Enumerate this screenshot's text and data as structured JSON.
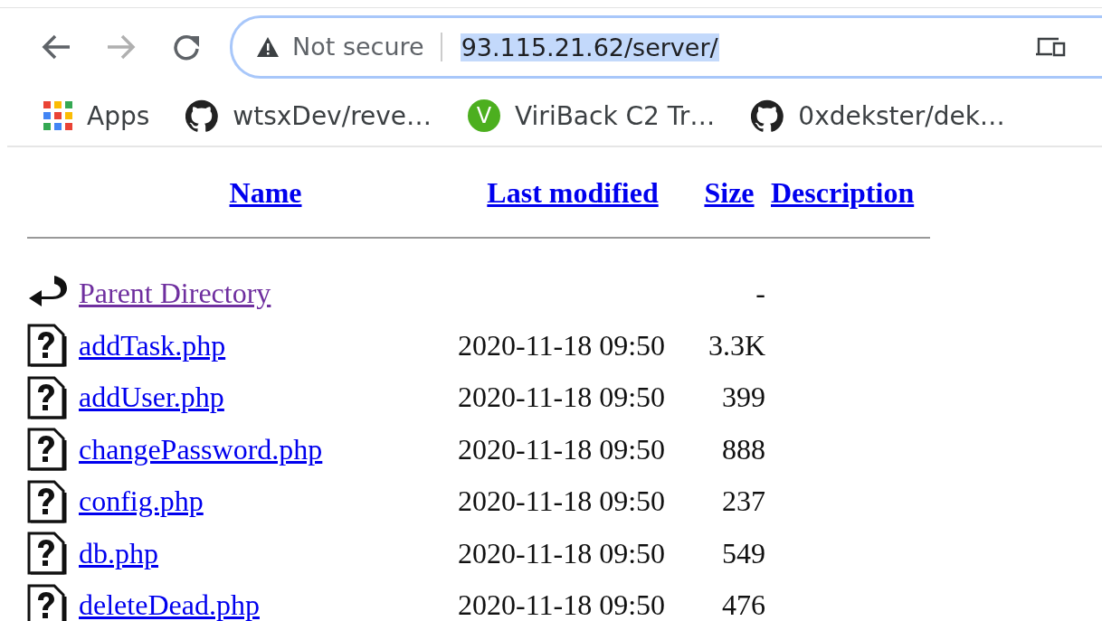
{
  "toolbar": {
    "nav": [
      {
        "kind": "back",
        "disabled": false
      },
      {
        "kind": "forward",
        "disabled": true
      },
      {
        "kind": "reload",
        "disabled": false
      }
    ],
    "security": "Not secure",
    "url": "93.115.21.62/server/",
    "url_selected": true
  },
  "bookmarks": [
    {
      "kind": "apps",
      "label": "Apps"
    },
    {
      "kind": "github",
      "label": "wtsxDev/reve…"
    },
    {
      "kind": "letter",
      "favicon_text": "V",
      "label": "ViriBack C2 Tr…"
    },
    {
      "kind": "github",
      "label": "0xdekster/dek…"
    }
  ],
  "listing": {
    "columns": [
      "Name",
      "Last modified",
      "Size",
      "Description"
    ],
    "rows": [
      {
        "kind": "parent",
        "name": "Parent Directory",
        "visited": true,
        "modified": "",
        "size": "-"
      },
      {
        "kind": "file",
        "name": "addTask.php",
        "visited": false,
        "modified": "2020-11-18 09:50",
        "size": "3.3K"
      },
      {
        "kind": "file",
        "name": "addUser.php",
        "visited": false,
        "modified": "2020-11-18 09:50",
        "size": "399"
      },
      {
        "kind": "file",
        "name": "changePassword.php",
        "visited": false,
        "modified": "2020-11-18 09:50",
        "size": "888"
      },
      {
        "kind": "file",
        "name": "config.php",
        "visited": false,
        "modified": "2020-11-18 09:50",
        "size": "237"
      },
      {
        "kind": "file",
        "name": "db.php",
        "visited": false,
        "modified": "2020-11-18 09:50",
        "size": "549"
      },
      {
        "kind": "file",
        "name": "deleteDead.php",
        "visited": false,
        "modified": "2020-11-18 09:50",
        "size": "476"
      }
    ]
  }
}
